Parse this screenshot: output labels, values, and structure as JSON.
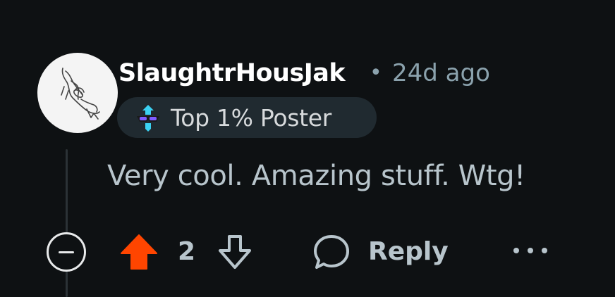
{
  "comment": {
    "author": "SlaughtrHousJak",
    "separator": "•",
    "age": "24d ago",
    "flair": {
      "icon": "top-poster-badge-icon",
      "text": "Top 1% Poster"
    },
    "body": "Very cool. Amazing stuff. Wtg!"
  },
  "actions": {
    "collapse_icon": "collapse-minus-icon",
    "upvote_icon": "upvote-arrow-icon",
    "score": "2",
    "downvote_icon": "downvote-arrow-icon",
    "reply_label": "Reply",
    "more_icon": "more-dots-icon"
  },
  "colors": {
    "background": "#0e1113",
    "upvote_active": "#ff4500",
    "muted_text": "#8ba2ad",
    "body_text": "#b8c5cc",
    "flair_bg": "#202a30"
  }
}
